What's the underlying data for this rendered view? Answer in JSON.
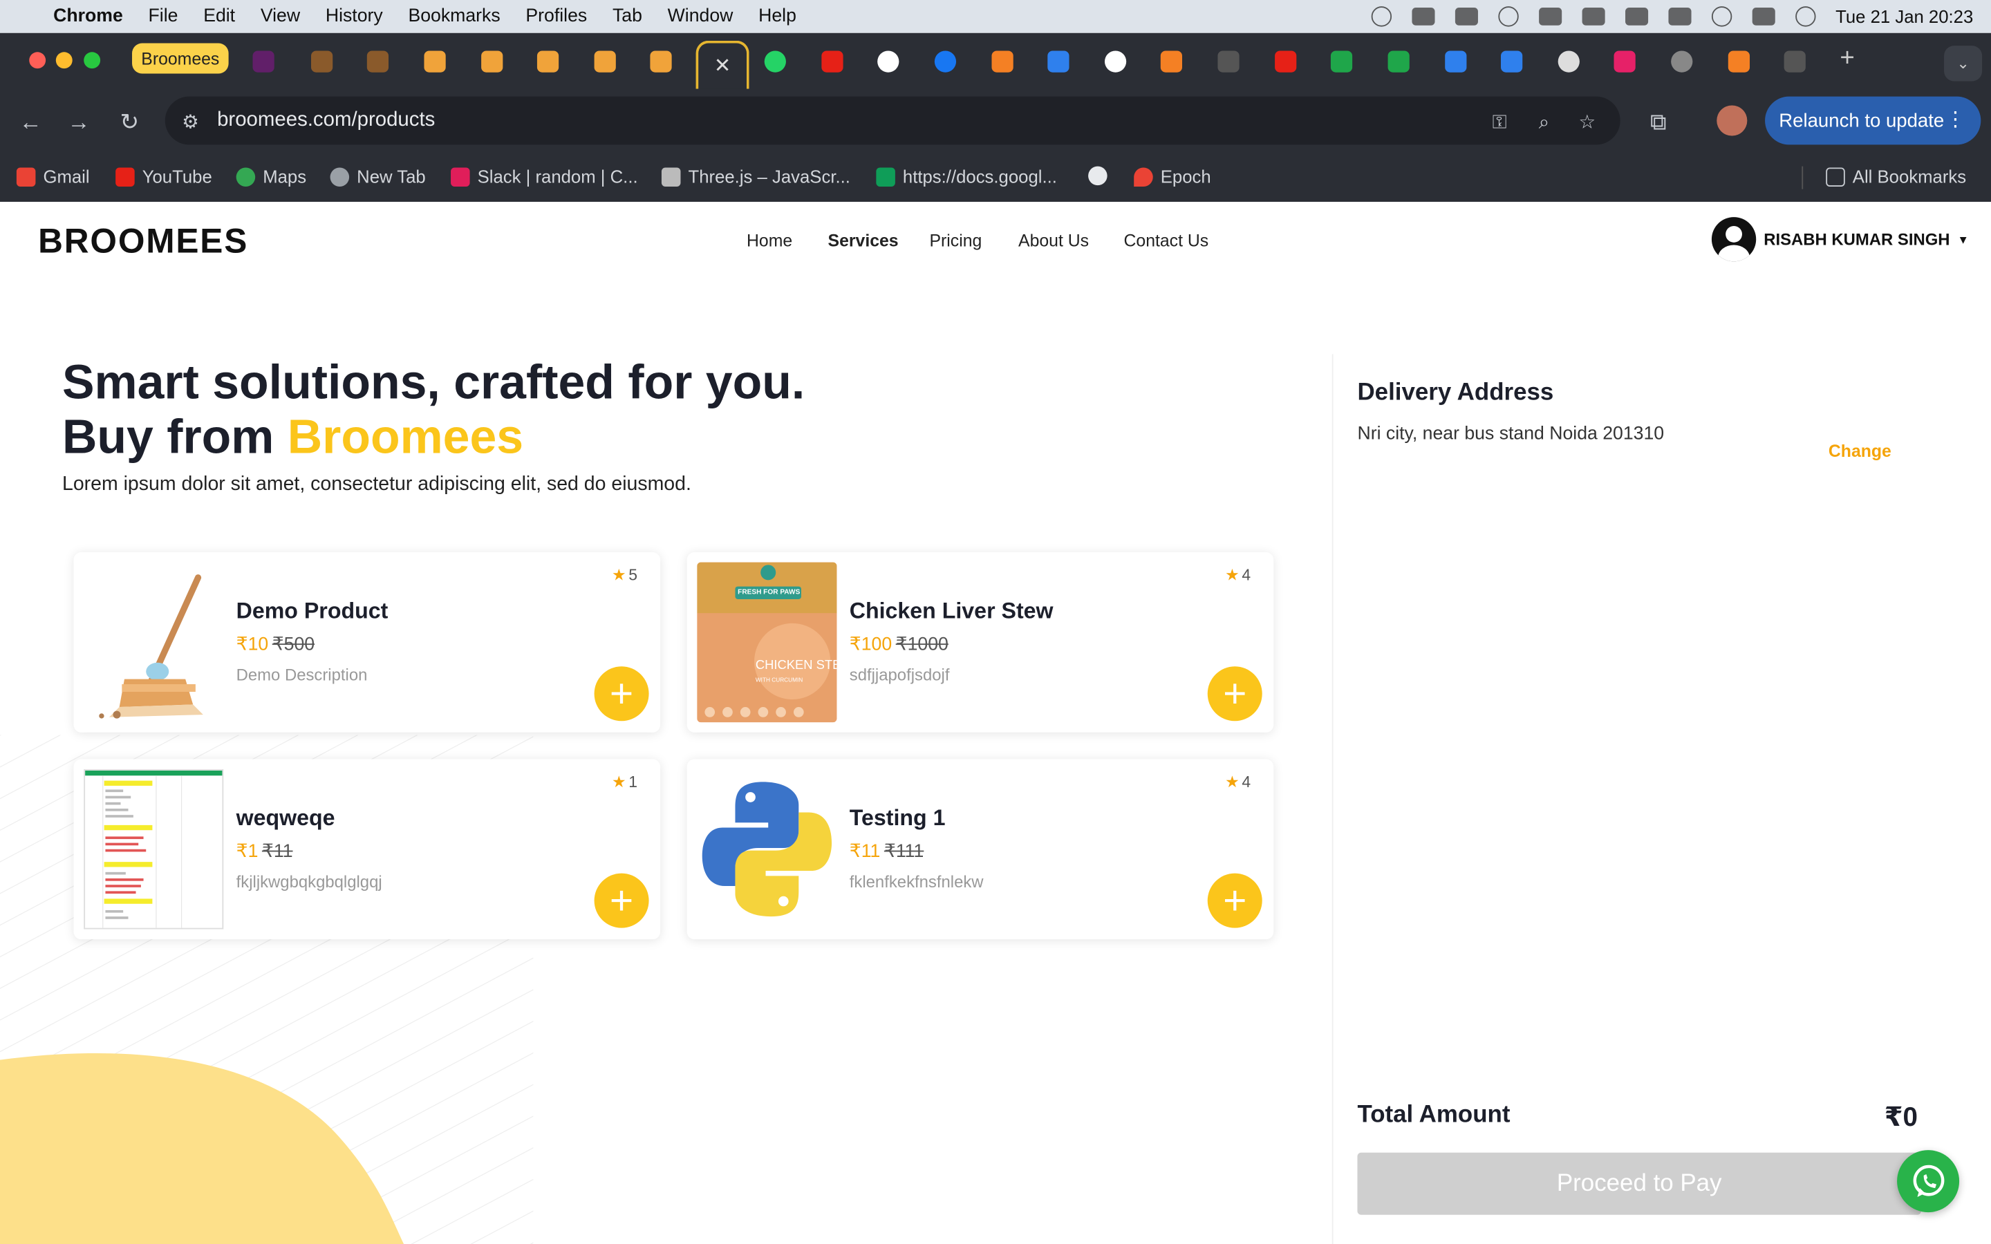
{
  "menubar": {
    "app": "Chrome",
    "items": [
      "File",
      "Edit",
      "View",
      "History",
      "Bookmarks",
      "Profiles",
      "Tab",
      "Window",
      "Help"
    ],
    "datetime": "Tue 21 Jan  20:23"
  },
  "browser": {
    "active_tab_title": "Broomees",
    "url": "broomees.com/products",
    "relaunch_label": "Relaunch to update",
    "bookmarks": [
      "Gmail",
      "YouTube",
      "Maps",
      "New Tab",
      "Slack | random | C...",
      "Three.js – JavaScr...",
      "https://docs.googl...",
      "Epoch"
    ],
    "all_bookmarks": "All Bookmarks"
  },
  "site": {
    "logo": "BROOMEES",
    "nav": [
      "Home",
      "Services",
      "Pricing",
      "About Us",
      "Contact Us"
    ],
    "user_name": "RISABH KUMAR SINGH",
    "hero_line1": "Smart solutions, crafted for you.",
    "hero_line2_prefix": "Buy from ",
    "hero_brand": "Broomees",
    "hero_sub": "Lorem ipsum dolor sit amet, consectetur adipiscing elit, sed do eiusmod."
  },
  "products": [
    {
      "name": "Demo Product",
      "price": "₹10",
      "was": "₹500",
      "desc": "Demo Description",
      "rating": "5",
      "image": "broom-icon"
    },
    {
      "name": "Chicken Liver Stew",
      "price": "₹100",
      "was": "₹1000",
      "desc": "sdfjjapofjsdojf",
      "rating": "4",
      "image": "pet-food-pack",
      "pack_brand": "FRESH FOR PAWS",
      "pack_label": "CHICKEN STEW",
      "pack_sub": "WITH CURCUMIN"
    },
    {
      "name": "weqweqe",
      "price": "₹1",
      "was": "₹11",
      "desc": "fkjljkwgbqkgbqlglgqj",
      "rating": "1",
      "image": "spreadsheet-thumbnail"
    },
    {
      "name": "Testing 1",
      "price": "₹11",
      "was": "₹111",
      "desc": "fklenfkekfnsfnlekw",
      "rating": "4",
      "image": "python-logo"
    }
  ],
  "cart": {
    "delivery_title": "Delivery Address",
    "address": "Nri city, near bus stand Noida 201310",
    "change_label": "Change",
    "total_label": "Total Amount",
    "total_value": "₹0",
    "pay_label": "Proceed to Pay"
  },
  "colors": {
    "brand_yellow": "#fbc51b",
    "price_orange": "#f5a40a",
    "chrome_dark": "#2b2e35",
    "whatsapp": "#29b34a"
  }
}
